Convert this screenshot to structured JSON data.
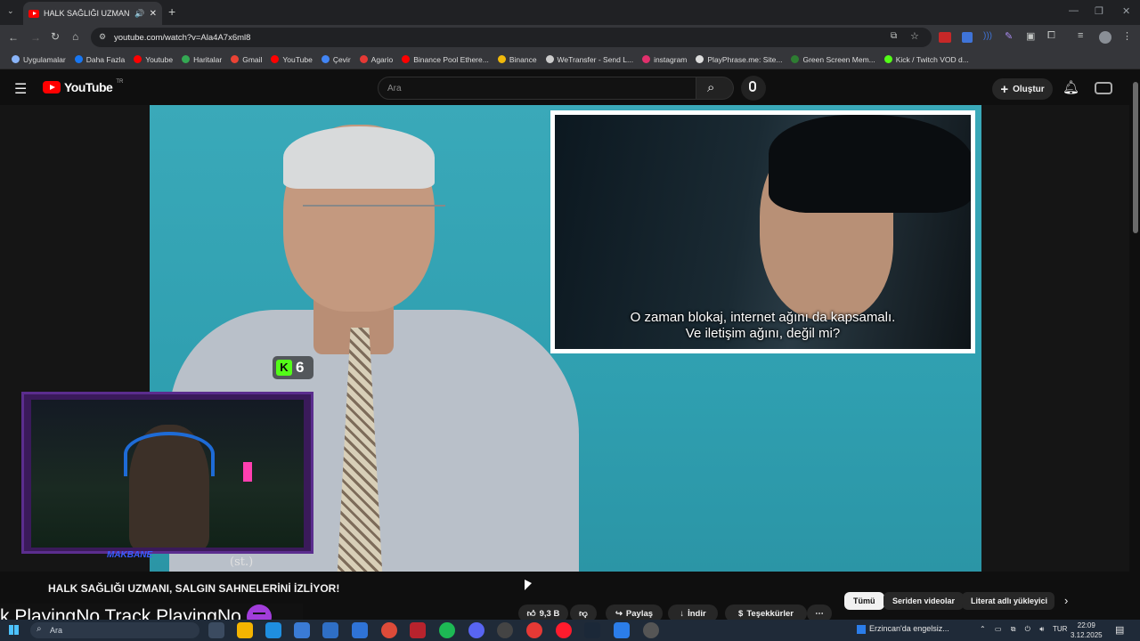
{
  "browser": {
    "tab_title": "HALK SAĞLIĞI UZMANI, SA",
    "url": "youtube.com/watch?v=Ala4A7x6ml8"
  },
  "bookmarks": [
    {
      "label": "Uygulamalar",
      "icon": "apps-grid-icon",
      "color": "#8ab4f8"
    },
    {
      "label": "Daha Fazla",
      "icon": "facebook-icon",
      "color": "#1877f2"
    },
    {
      "label": "Youtube",
      "icon": "youtube-icon",
      "color": "#ff0000"
    },
    {
      "label": "Haritalar",
      "icon": "maps-icon",
      "color": "#34a853"
    },
    {
      "label": "Gmail",
      "icon": "gmail-icon",
      "color": "#ea4335"
    },
    {
      "label": "YouTube",
      "icon": "youtube-icon",
      "color": "#ff0000"
    },
    {
      "label": "Çevir",
      "icon": "translate-icon",
      "color": "#4285f4"
    },
    {
      "label": "Agario",
      "icon": "agario-icon",
      "color": "#e53935"
    },
    {
      "label": "Binance Pool Ethere...",
      "icon": "youtube-icon",
      "color": "#ff0000"
    },
    {
      "label": "Binance",
      "icon": "binance-icon",
      "color": "#f0b90b"
    },
    {
      "label": "WeTransfer - Send L...",
      "icon": "wetransfer-icon",
      "color": "#cccccc"
    },
    {
      "label": "instagram",
      "icon": "instagram-icon",
      "color": "#e1306c"
    },
    {
      "label": "PlayPhrase.me: Site...",
      "icon": "playphrase-icon",
      "color": "#dddddd"
    },
    {
      "label": "Green Screen Mem...",
      "icon": "green-screen-icon",
      "color": "#2e7d32"
    },
    {
      "label": "Kick / Twitch VOD d...",
      "icon": "kick-icon",
      "color": "#53fc18"
    }
  ],
  "youtube": {
    "logo_text": "YouTube",
    "country_code": "TR",
    "search_placeholder": "Ara",
    "create_label": "Oluştur",
    "accent": "#ff0000"
  },
  "video": {
    "subtitle_line1": "O zaman blokaj, internet ağını da kapsamalı.",
    "subtitle_line2": "Ve iletişim ağını, değil mi?",
    "kick_badge_letter": "K",
    "kick_badge_number": "6",
    "overlay_label": "(st.)",
    "webcam_tag": "MAKBANE",
    "title": "HALK SAĞLIĞI UZMANI, SALGIN SAHNELERİNİ İZLİYOR!"
  },
  "actions": {
    "like_count": "9,3 B",
    "share": "Paylaş",
    "download": "İndir",
    "thanks": "Teşekkürler"
  },
  "chips": [
    "Tümü",
    "Seriden videolar",
    "Literat adlı yükleyici"
  ],
  "ticker_text": "k PlayingNo Track PlayingNo",
  "taskbar": {
    "search_placeholder": "Ara",
    "weather": "Erzincan'da engelsiz...",
    "language": "TUR",
    "time": "22:09",
    "date": "3.12.2025"
  }
}
